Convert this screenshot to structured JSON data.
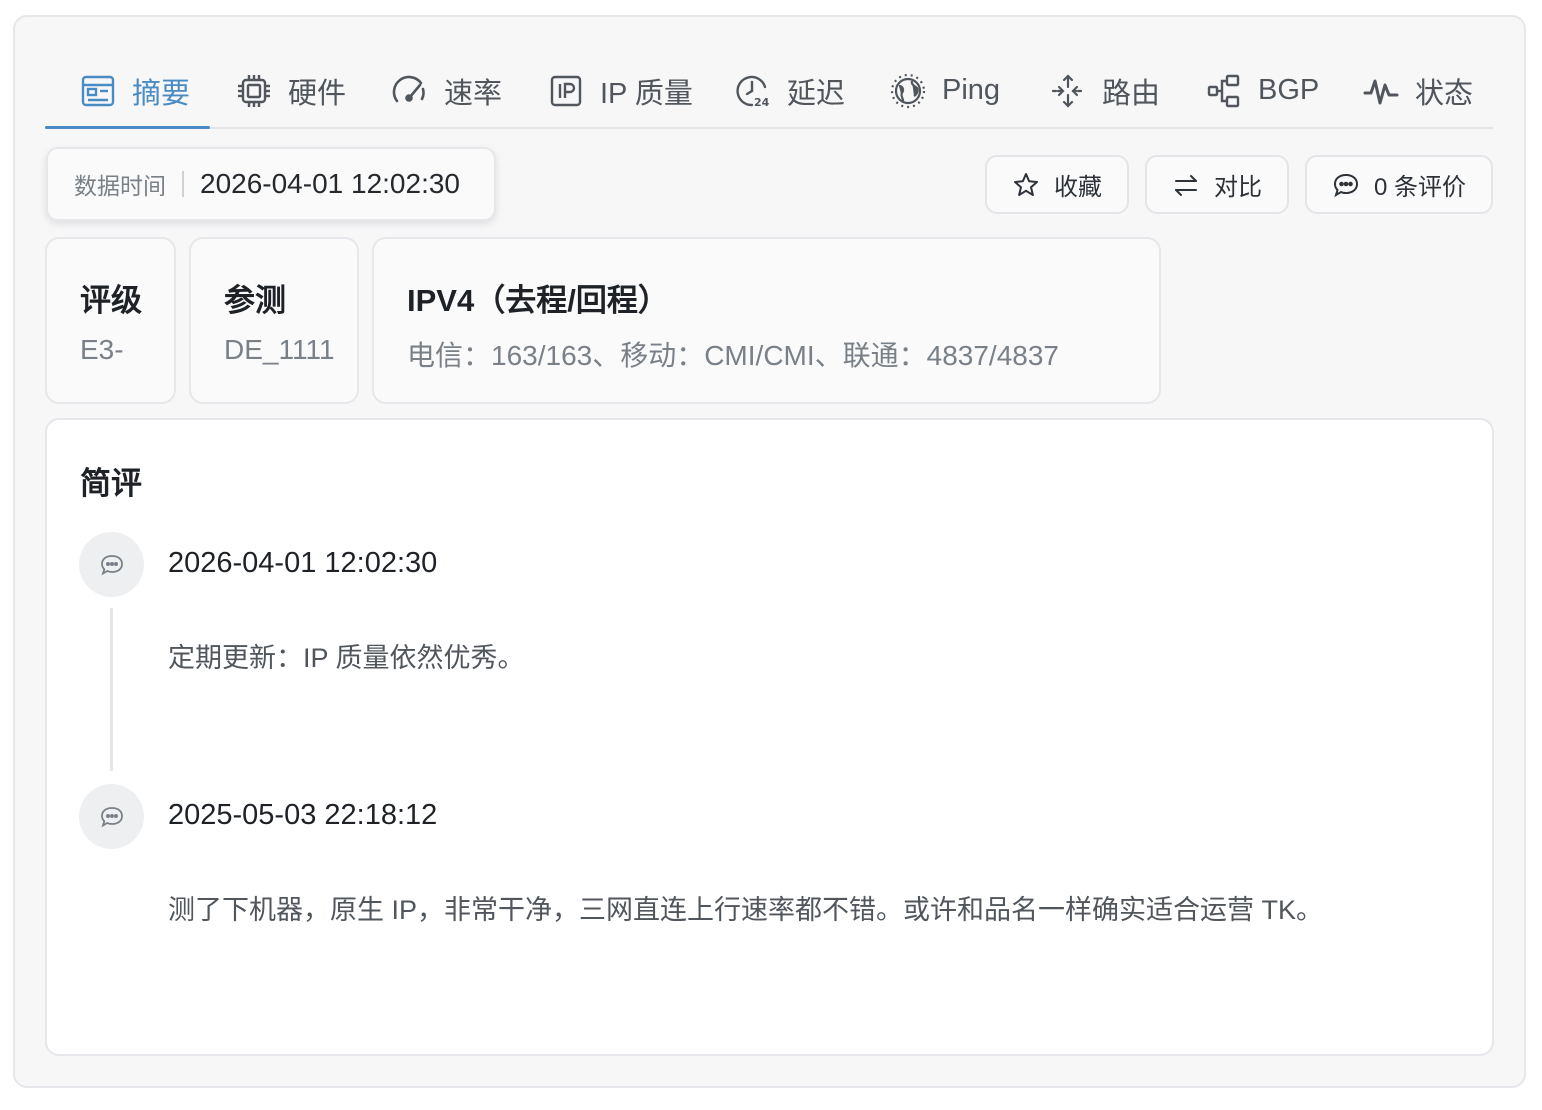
{
  "tabs": [
    {
      "label": "摘要",
      "icon": "summary-icon",
      "active": true
    },
    {
      "label": "硬件",
      "icon": "chip-icon",
      "active": false
    },
    {
      "label": "速率",
      "icon": "speedometer-icon",
      "active": false
    },
    {
      "label": "IP 质量",
      "icon": "ip-icon",
      "active": false
    },
    {
      "label": "延迟",
      "icon": "clock-24-icon",
      "active": false
    },
    {
      "label": "Ping",
      "icon": "globe-icon",
      "active": false
    },
    {
      "label": "路由",
      "icon": "route-arrows-icon",
      "active": false
    },
    {
      "label": "BGP",
      "icon": "bgp-nodes-icon",
      "active": false
    },
    {
      "label": "状态",
      "icon": "pulse-icon",
      "active": false
    }
  ],
  "data_time": {
    "label": "数据时间",
    "value": "2026-04-01 12:02:30"
  },
  "actions": {
    "favorite_label": "收藏",
    "compare_label": "对比",
    "reviews_label": "0 条评价"
  },
  "cards": {
    "rating": {
      "title": "评级",
      "value": "E3-"
    },
    "probe": {
      "title": "参测",
      "value": "DE_1111"
    },
    "ipv4": {
      "title": "IPV4（去程/回程）",
      "value": "电信：163/163、移动：CMI/CMI、联通：4837/4837"
    }
  },
  "review": {
    "title": "简评",
    "entries": [
      {
        "time": "2026-04-01 12:02:30",
        "text": "定期更新：IP 质量依然优秀。"
      },
      {
        "time": "2025-05-03 22:18:12",
        "text": "测了下机器，原生 IP，非常干净，三网直连上行速率都不错。或许和品名一样确实适合运营 TK。"
      }
    ]
  },
  "colors": {
    "accent": "#4a8bc4",
    "text": "#1e2226",
    "muted": "#7a8087",
    "border": "#e6e7ea"
  }
}
